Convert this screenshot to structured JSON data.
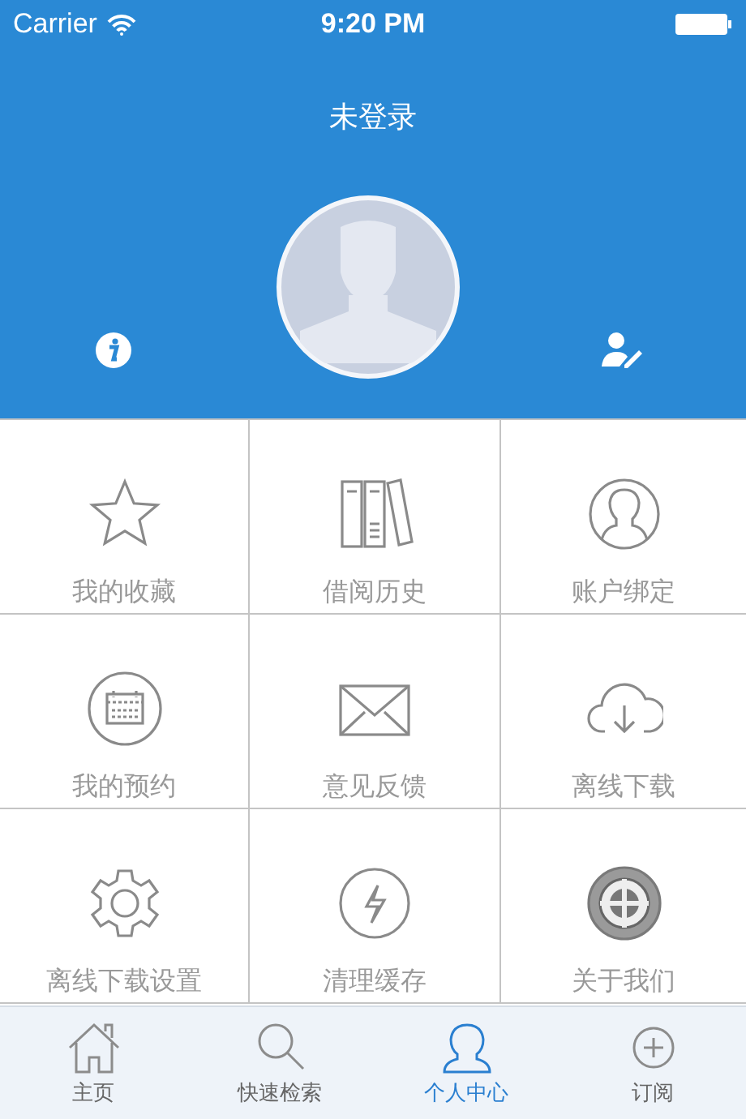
{
  "status_bar": {
    "carrier": "Carrier",
    "time": "9:20 PM"
  },
  "header": {
    "title": "未登录"
  },
  "grid": [
    {
      "label": "我的收藏",
      "kind": "star"
    },
    {
      "label": "借阅历史",
      "kind": "books"
    },
    {
      "label": "账户绑定",
      "kind": "user"
    },
    {
      "label": "我的预约",
      "kind": "calendar"
    },
    {
      "label": "意见反馈",
      "kind": "mail"
    },
    {
      "label": "离线下载",
      "kind": "cloud"
    },
    {
      "label": "离线下载设置",
      "kind": "gear"
    },
    {
      "label": "清理缓存",
      "kind": "bolt"
    },
    {
      "label": "关于我们",
      "kind": "emblem"
    }
  ],
  "tabs": [
    {
      "label": "主页",
      "kind": "home",
      "selected": false
    },
    {
      "label": "快速检索",
      "kind": "search",
      "selected": false
    },
    {
      "label": "个人中心",
      "kind": "user",
      "selected": true
    },
    {
      "label": "订阅",
      "kind": "plus",
      "selected": false
    }
  ]
}
